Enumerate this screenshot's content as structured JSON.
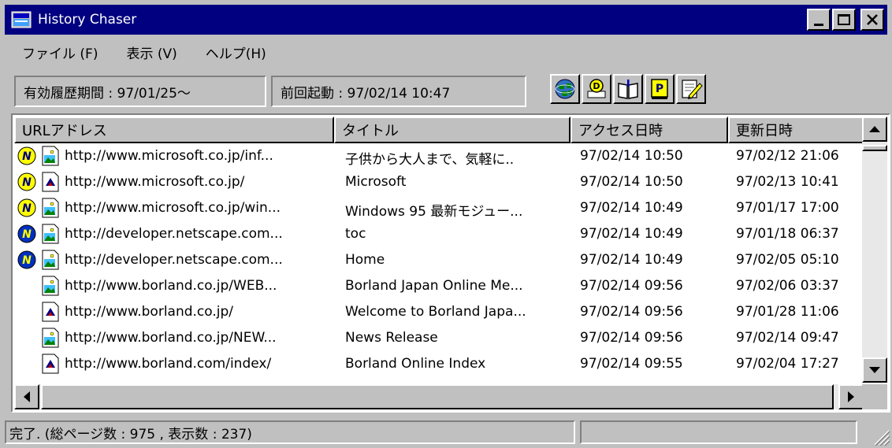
{
  "window": {
    "title": "History Chaser"
  },
  "menu": {
    "items": [
      "ファイル (F)",
      "表示 (V)",
      "ヘルプ(H)"
    ]
  },
  "info": {
    "valid_period": "有効履歴期間 : 97/01/25〜",
    "last_launch": "前回起動 : 97/02/14 10:47"
  },
  "toolbar": {
    "icons": [
      "globe-icon",
      "search-icon",
      "book-icon",
      "print-icon",
      "edit-icon"
    ]
  },
  "list": {
    "columns": [
      "URLアドレス",
      "タイトル",
      "アクセス日時",
      "更新日時"
    ],
    "rows": [
      {
        "nav": "netscape-icon-yellow",
        "file": "image-page-icon",
        "url": "http://www.microsoft.co.jp/inf...",
        "title": "子供から大人まで、気軽に..",
        "access": "97/02/14 10:50",
        "updated": "97/02/12 21:06"
      },
      {
        "nav": "netscape-icon-yellow",
        "file": "html-page-icon",
        "url": "http://www.microsoft.co.jp/",
        "title": "Microsoft",
        "access": "97/02/14 10:50",
        "updated": "97/02/13 10:41"
      },
      {
        "nav": "netscape-icon-yellow",
        "file": "image-page-icon",
        "url": "http://www.microsoft.co.jp/win...",
        "title": "Windows 95 最新モジュー...",
        "access": "97/02/14 10:49",
        "updated": "97/01/17 17:00"
      },
      {
        "nav": "netscape-icon-blue",
        "file": "image-page-icon",
        "url": "http://developer.netscape.com...",
        "title": "toc",
        "access": "97/02/14 10:49",
        "updated": "97/01/18 06:37"
      },
      {
        "nav": "netscape-icon-blue",
        "file": "image-page-icon",
        "url": "http://developer.netscape.com...",
        "title": "Home",
        "access": "97/02/14 10:49",
        "updated": "97/02/05 05:10"
      },
      {
        "nav": "",
        "file": "image-page-icon",
        "url": "http://www.borland.co.jp/WEB...",
        "title": "Borland Japan Online Me...",
        "access": "97/02/14 09:56",
        "updated": "97/02/06 03:37"
      },
      {
        "nav": "",
        "file": "html-page-icon",
        "url": "http://www.borland.co.jp/",
        "title": "Welcome to Borland Japa...",
        "access": "97/02/14 09:56",
        "updated": "97/01/28 11:06"
      },
      {
        "nav": "",
        "file": "image-page-icon",
        "url": "http://www.borland.co.jp/NEW...",
        "title": "News Release",
        "access": "97/02/14 09:56",
        "updated": "97/02/14 09:47"
      },
      {
        "nav": "",
        "file": "html-page-icon",
        "url": "http://www.borland.com/index/",
        "title": "Borland Online Index",
        "access": "97/02/14 09:55",
        "updated": "97/02/04 17:27"
      }
    ]
  },
  "status": {
    "text": "完了. (総ページ数 : 975 , 表示数 : 237)"
  },
  "colors": {
    "titlebar": "#000080",
    "face": "#c0c0c0",
    "list_bg": "#ffffff"
  }
}
